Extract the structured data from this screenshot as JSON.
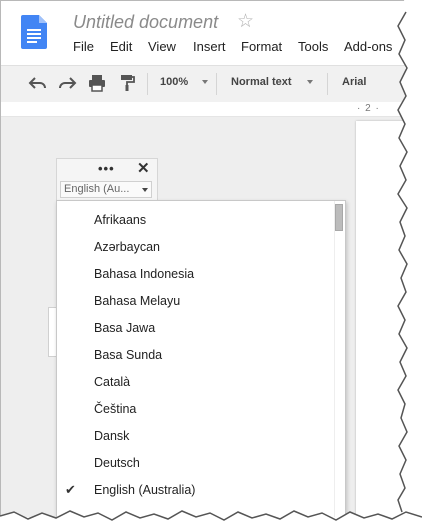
{
  "header": {
    "title": "Untitled document",
    "menu": [
      "File",
      "Edit",
      "View",
      "Insert",
      "Format",
      "Tools",
      "Add-ons"
    ]
  },
  "toolbar": {
    "zoom": "100%",
    "style": "Normal text",
    "font": "Arial"
  },
  "ruler": {
    "marks": "· 2 ·"
  },
  "language_widget": {
    "drag_handle": "•••",
    "close": "✕",
    "selected": "English (Au..."
  },
  "languages": [
    {
      "label": "Afrikaans",
      "checked": false
    },
    {
      "label": "Azərbaycan",
      "checked": false
    },
    {
      "label": "Bahasa Indonesia",
      "checked": false
    },
    {
      "label": "Bahasa Melayu",
      "checked": false
    },
    {
      "label": "Basa Jawa",
      "checked": false
    },
    {
      "label": "Basa Sunda",
      "checked": false
    },
    {
      "label": "Català",
      "checked": false
    },
    {
      "label": "Čeština",
      "checked": false
    },
    {
      "label": "Dansk",
      "checked": false
    },
    {
      "label": "Deutsch",
      "checked": false
    },
    {
      "label": "English (Australia)",
      "checked": true
    }
  ],
  "colors": {
    "docs_blue": "#4285f4",
    "toolbar_bg": "#f1f1f1",
    "canvas_bg": "#eeeeee"
  }
}
